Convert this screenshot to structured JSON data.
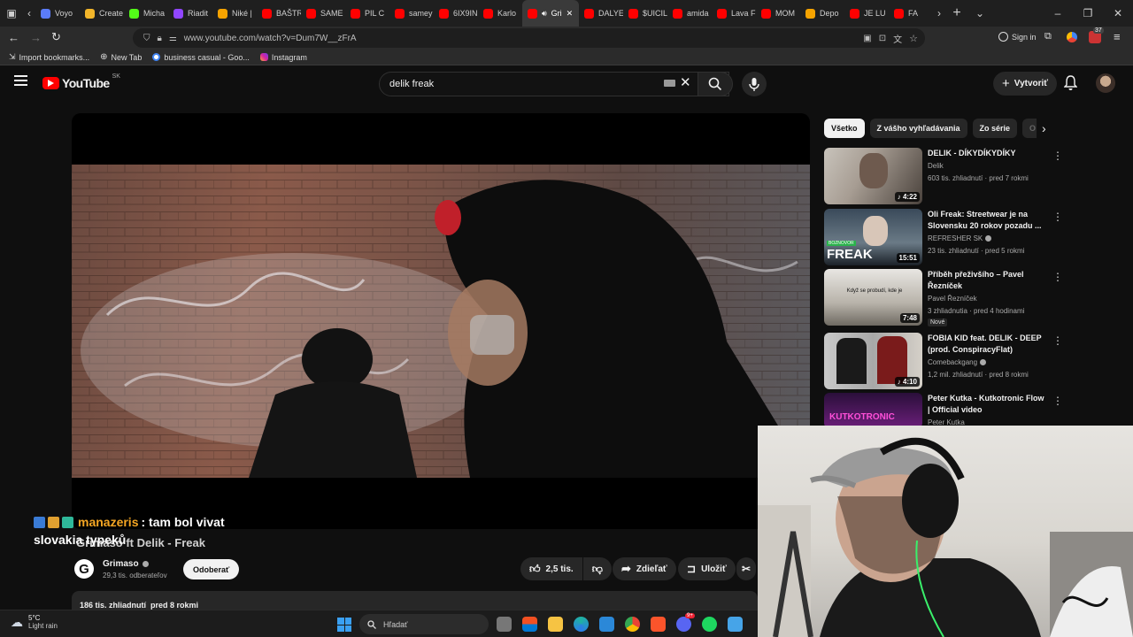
{
  "browser": {
    "tabs": [
      {
        "label": "Voyo",
        "color": "#5b7cfa"
      },
      {
        "label": "Create",
        "color": "#f2b52a"
      },
      {
        "label": "Micha",
        "color": "#53fc18"
      },
      {
        "label": "Riadit",
        "color": "#9146ff"
      },
      {
        "label": "Niké |",
        "color": "#f6a300"
      },
      {
        "label": "BAŠTR",
        "color": "#ff0000"
      },
      {
        "label": "SAME",
        "color": "#ff0000"
      },
      {
        "label": "PIL C",
        "color": "#ff0000"
      },
      {
        "label": "samey",
        "color": "#ff0000"
      },
      {
        "label": "6IX9IN",
        "color": "#ff0000"
      },
      {
        "label": "Karlo",
        "color": "#ff0000"
      },
      {
        "label": "Gri",
        "color": "#ff0000"
      },
      {
        "label": "DALYE",
        "color": "#ff0000"
      },
      {
        "label": "$UICIL",
        "color": "#ff0000"
      },
      {
        "label": "amida",
        "color": "#ff0000"
      },
      {
        "label": "Lava F",
        "color": "#ff0000"
      },
      {
        "label": "MOM",
        "color": "#ff0000"
      },
      {
        "label": "Depo",
        "color": "#f6a300"
      },
      {
        "label": "JE LU",
        "color": "#ff0000"
      },
      {
        "label": "FA",
        "color": "#ff0000"
      }
    ],
    "url": "www.youtube.com/watch?v=Dum7W__zFrA",
    "sign_in": "Sign in",
    "ext_badge": "37",
    "bookmarks": [
      {
        "label": "Import bookmarks...",
        "icon": "import-icon"
      },
      {
        "label": "New Tab",
        "icon": "globe-icon"
      },
      {
        "label": "business casual - Goo...",
        "icon": "google-icon"
      },
      {
        "label": "Instagram",
        "icon": "instagram-icon"
      }
    ]
  },
  "youtube": {
    "logo_text": "YouTube",
    "region": "SK",
    "search_value": "delik freak",
    "create_label": "Vytvoriť",
    "chips": [
      "Všetko",
      "Z vášho vyhľadávania",
      "Zo série",
      "O"
    ],
    "video": {
      "title": "Grimaso ft Delik - Freak",
      "channel": "Grimaso",
      "subscribers": "29,3 tis. odberateľov",
      "subscribe_label": "Odoberať",
      "likes": "2,5 tis.",
      "share_label": "Zdieľať",
      "save_label": "Uložiť",
      "views_date": "186 tis. zhliadnutí  pred 8 rokmi"
    },
    "recommendations": [
      {
        "title": "DELIK - DÍKYDÍKYDÍKY",
        "channel": "Delik",
        "verified": false,
        "meta": "603 tis. zhliadnutí · pred 7 rokmi",
        "duration": "4:22",
        "badge": ""
      },
      {
        "title": "Oli Freak: Streetwear je na Slovensku 20 rokov pozadu ...",
        "channel": "REFRESHER SK",
        "verified": true,
        "meta": "23 tis. zhliadnutí · pred 5 rokmi",
        "duration": "15:51",
        "badge": ""
      },
      {
        "title": "Příběh přeživšího – Pavel Řezníček",
        "channel": "Pavel Řezníček",
        "verified": false,
        "meta": "3 zhliadnutia · pred 4 hodinami",
        "duration": "7:48",
        "badge": "Nové"
      },
      {
        "title": "FOBIA KID feat. DELIK - DEEP (prod. ConspiracyFlat)",
        "channel": "Comebackgang",
        "verified": true,
        "meta": "1,2 mil. zhliadnutí · pred 8 rokmi",
        "duration": "4:10",
        "badge": ""
      },
      {
        "title": "Peter Kutka - Kutkotronic Flow | Official video",
        "channel": "Peter Kutka",
        "verified": false,
        "meta": "",
        "duration": "",
        "badge": ""
      }
    ],
    "thumb_text": {
      "freak": "FREAK",
      "boznovor": "BOZNOVOR",
      "kutkotronic": "KUTKOTRONIC",
      "kdyz": "Když se probudí, kde je"
    }
  },
  "chat_overlay": {
    "user": "manazeris",
    "message": ": tam bol vivat",
    "message2": "slovakia typeků"
  },
  "taskbar": {
    "temp": "5°C",
    "weather": "Light rain",
    "search_placeholder": "Hľadať",
    "discord_badge": "9+"
  }
}
